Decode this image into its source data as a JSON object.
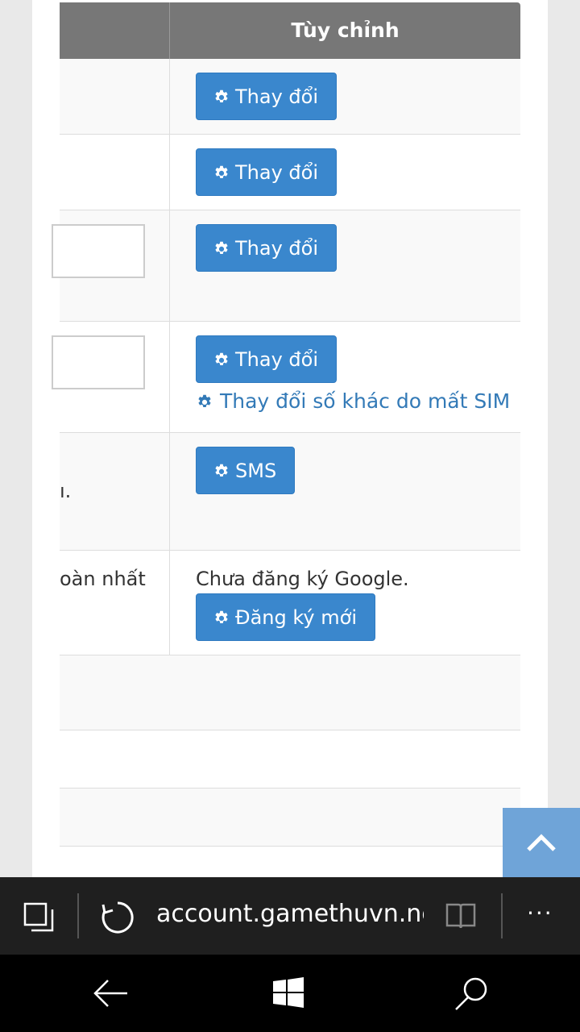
{
  "table": {
    "header_right": "Tùy chỉnh",
    "rows": {
      "r1": {
        "button": "Thay đổi"
      },
      "r2": {
        "button": "Thay đổi"
      },
      "r3": {
        "button": "Thay đổi"
      },
      "r4": {
        "button": "Thay đổi",
        "link": "Thay đổi số khác do mất SIM"
      },
      "r5": {
        "left_text": "ı.",
        "button": "SMS"
      },
      "r6": {
        "left_text": "oàn nhất",
        "status": "Chưa đăng ký Google.",
        "button": "Đăng ký mới"
      }
    }
  },
  "browser": {
    "url": "account.gamethuvn.net",
    "more": "···"
  },
  "icons": {
    "gear": "gear-icon",
    "scroll_top": "chevron-up-icon",
    "tabs": "tabs-icon",
    "refresh": "refresh-icon",
    "reading": "reading-view-icon",
    "back": "back-arrow-icon",
    "windows": "windows-logo-icon",
    "search": "search-icon"
  },
  "colors": {
    "button": "#3a87cd",
    "header": "#777777",
    "link": "#337ab7",
    "scroll_top": "#6fa4d8"
  }
}
